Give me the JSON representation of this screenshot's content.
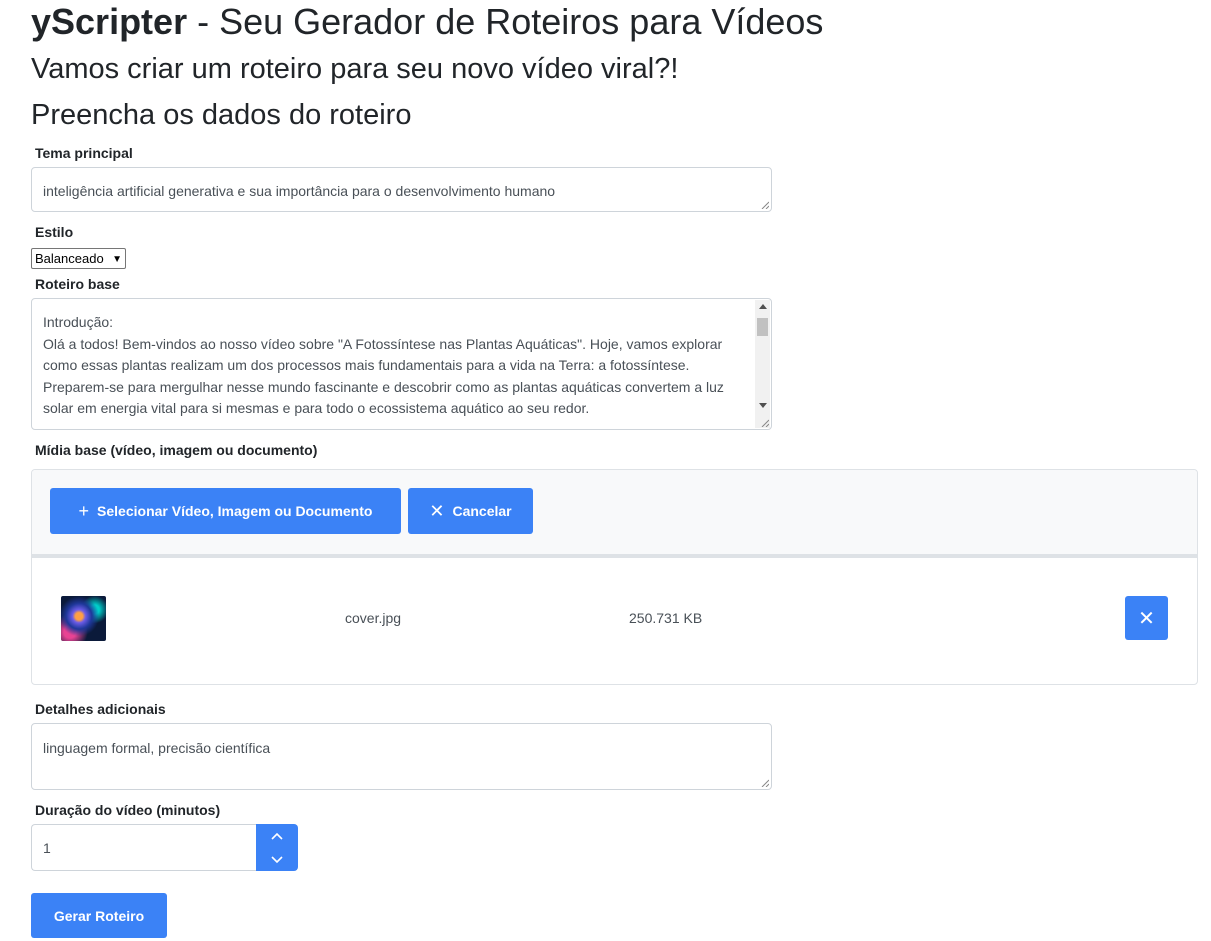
{
  "header": {
    "app_name": "yScripter",
    "title_rest": " - Seu Gerador de Roteiros para Vídeos",
    "subtitle": "Vamos criar um roteiro para seu novo vídeo viral?!",
    "section_title": "Preencha os dados do roteiro"
  },
  "form": {
    "tema": {
      "label": "Tema principal",
      "value": "inteligência artificial generativa e sua importância para o desenvolvimento humano"
    },
    "estilo": {
      "label": "Estilo",
      "selected": "Balanceado"
    },
    "roteiro": {
      "label": "Roteiro base",
      "lines": [
        "Introdução:",
        "Olá a todos! Bem-vindos ao nosso vídeo sobre \"A Fotossíntese nas Plantas Aquáticas\". Hoje, vamos explorar",
        "como essas plantas realizam um dos processos mais fundamentais para a vida na Terra: a fotossíntese.",
        "Preparem-se para mergulhar nesse mundo fascinante e descobrir como as plantas aquáticas convertem a luz",
        "solar em energia vital para si mesmas e para todo o ecossistema aquático ao seu redor."
      ]
    },
    "midia": {
      "label": "Mídia base (vídeo, imagem ou documento)",
      "select_label": "Selecionar Vídeo, Imagem ou Documento",
      "cancel_label": "Cancelar",
      "file": {
        "name": "cover.jpg",
        "size": "250.731 KB"
      }
    },
    "detalhes": {
      "label": "Detalhes adicionais",
      "value": "linguagem formal, precisão científica"
    },
    "duracao": {
      "label": "Duração do vídeo (minutos)",
      "value": "1"
    },
    "submit_label": "Gerar Roteiro"
  },
  "colors": {
    "accent": "#3b82f6",
    "text": "#212529",
    "border": "#ced4da"
  }
}
